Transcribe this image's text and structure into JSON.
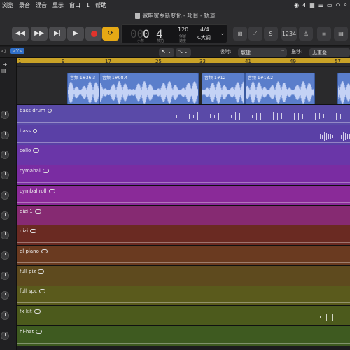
{
  "menubar": {
    "items": [
      "浏览",
      "录音",
      "混音",
      "显示",
      "窗口",
      "1",
      "帮助"
    ],
    "status_count": "4"
  },
  "window": {
    "title": "歌唱家乡新变化 - 项目 - 轨道"
  },
  "transport": {
    "lcd": {
      "bar": "00",
      "beat": "0",
      "beat2": "4",
      "bar_label": "小节",
      "beat_label": "节拍",
      "tempo": "120",
      "tempo_label1": "保留",
      "tempo_label2": "速度",
      "time_signature": "4/4",
      "key": "C大调"
    },
    "count_in_label": "1234"
  },
  "toolrow": {
    "snap_label": "吸附:",
    "snap_value": "敏捷",
    "drag_label": "拖移:",
    "drag_value": "无重叠"
  },
  "ruler": {
    "bars": [
      "1",
      "9",
      "17",
      "25",
      "33",
      "41",
      "49",
      "57"
    ]
  },
  "regions": [
    {
      "label": "音频 1#36.3"
    },
    {
      "label": "音频 1#08.4"
    },
    {
      "label": "音频 1#12"
    },
    {
      "label": "音频 1#13.2"
    }
  ],
  "tracks": [
    {
      "name": "bass drum",
      "color": "#5a4aa8"
    },
    {
      "name": "bass",
      "color": "#5a40a6"
    },
    {
      "name": "cello",
      "color": "#6a36a8"
    },
    {
      "name": "cymabal",
      "color": "#7a2ca2"
    },
    {
      "name": "cymbal roll",
      "color": "#8a2a98"
    },
    {
      "name": "dizi 1",
      "color": "#862a72"
    },
    {
      "name": "dizi",
      "color": "#6a2a22"
    },
    {
      "name": "el piano",
      "color": "#6a3a20"
    },
    {
      "name": "full piz",
      "color": "#5e4a1e"
    },
    {
      "name": "full spc",
      "color": "#5a5a1c"
    },
    {
      "name": "fx kit",
      "color": "#4c5a1c"
    },
    {
      "name": "hi-hat",
      "color": "#3e5a20"
    }
  ]
}
